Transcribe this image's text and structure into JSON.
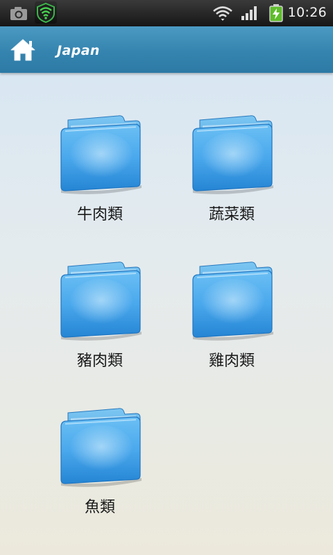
{
  "status_bar": {
    "time": "10:26",
    "icons": [
      "camera-icon",
      "shield-wifi-app-icon",
      "wifi-icon",
      "signal-icon",
      "battery-charging-icon"
    ]
  },
  "header": {
    "title": "Japan",
    "home_icon": "home-icon"
  },
  "categories": [
    {
      "label": "牛肉類",
      "icon": "folder-icon"
    },
    {
      "label": "蔬菜類",
      "icon": "folder-icon"
    },
    {
      "label": "豬肉類",
      "icon": "folder-icon"
    },
    {
      "label": "雞肉類",
      "icon": "folder-icon"
    },
    {
      "label": "魚類",
      "icon": "folder-icon"
    }
  ],
  "colors": {
    "header": "#3584af",
    "folder": "#4aa8e8"
  }
}
